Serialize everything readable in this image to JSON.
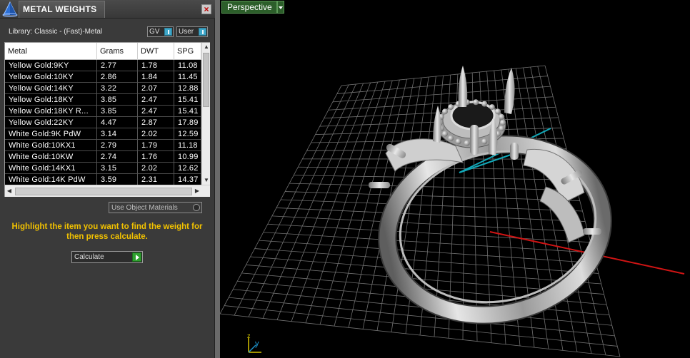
{
  "panel": {
    "title": "METAL WEIGHTS",
    "close_symbol": "×",
    "library_label": "Library: Classic - (Fast)-Metal",
    "gv_combo": "GV",
    "user_combo": "User",
    "use_object_materials": "Use Object Materials",
    "hint": "Highlight the item you want to find the weight for then press calculate.",
    "calculate_label": "Calculate"
  },
  "table": {
    "columns": [
      "Metal",
      "Grams",
      "DWT",
      "SPG"
    ],
    "rows": [
      [
        "Yellow Gold:9KY",
        "2.77",
        "1.78",
        "11.08"
      ],
      [
        "Yellow Gold:10KY",
        "2.86",
        "1.84",
        "11.45"
      ],
      [
        "Yellow Gold:14KY",
        "3.22",
        "2.07",
        "12.88"
      ],
      [
        "Yellow Gold:18KY",
        "3.85",
        "2.47",
        "15.41"
      ],
      [
        "Yellow Gold:18KY R...",
        "3.85",
        "2.47",
        "15.41"
      ],
      [
        "Yellow Gold:22KY",
        "4.47",
        "2.87",
        "17.89"
      ],
      [
        "White Gold:9K PdW",
        "3.14",
        "2.02",
        "12.59"
      ],
      [
        "White Gold:10KX1",
        "2.79",
        "1.79",
        "11.18"
      ],
      [
        "White Gold:10KW",
        "2.74",
        "1.76",
        "10.99"
      ],
      [
        "White Gold:14KX1",
        "3.15",
        "2.02",
        "12.62"
      ],
      [
        "White Gold:14K PdW",
        "3.59",
        "2.31",
        "14.37"
      ]
    ]
  },
  "viewport": {
    "view_name": "Perspective",
    "axis_labels": {
      "z": "z",
      "y": "y"
    }
  },
  "icons": {
    "app": "pyramid-app-icon",
    "close": "close-icon",
    "dropdown": "dropdown-arrow-icon",
    "go": "play-arrow-icon"
  },
  "colors": {
    "hint": "#f1c100",
    "grid": "#707070",
    "axis_x": "#d01414",
    "axis_y": "#12a8b8",
    "view_label_bg": "#2c5e2a"
  }
}
